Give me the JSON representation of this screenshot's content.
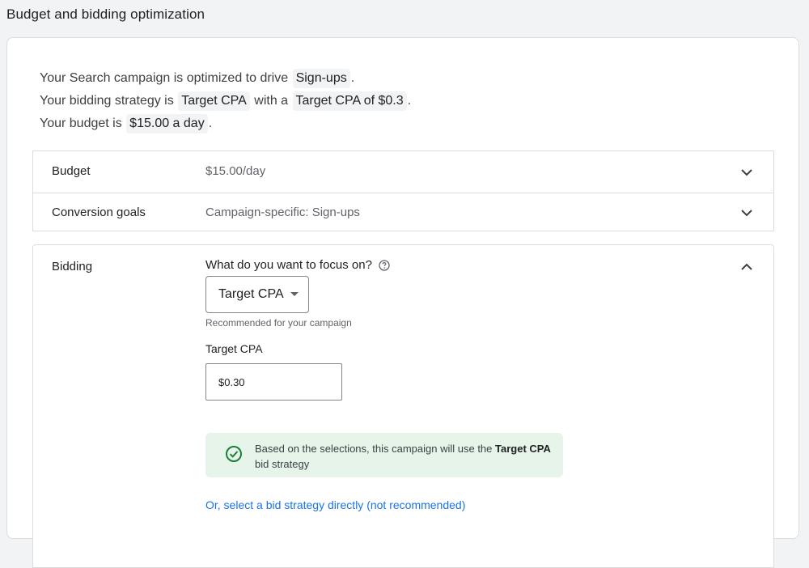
{
  "header": {
    "title": "Budget and bidding optimization"
  },
  "summary": {
    "line1_prefix": "Your Search campaign is optimized to drive",
    "line1_chip": "Sign-ups",
    "line1_suffix": ".",
    "line2_prefix": "Your bidding strategy is",
    "line2_chip1": "Target CPA",
    "line2_mid": "with a",
    "line2_chip2": "Target CPA of $0.3",
    "line2_suffix": ".",
    "line3_prefix": "Your budget is",
    "line3_chip": "$15.00 a day",
    "line3_suffix": "."
  },
  "rows": {
    "budget": {
      "label": "Budget",
      "value": "$15.00/day"
    },
    "conversion": {
      "label": "Conversion goals",
      "value": "Campaign-specific: Sign-ups"
    }
  },
  "bidding": {
    "label": "Bidding",
    "question": "What do you want to focus on?",
    "selected": "Target CPA",
    "recommended": "Recommended for your campaign",
    "tcpa_label": "Target CPA",
    "tcpa_value": "$0.30",
    "notice_prefix": "Based on the selections, this campaign will use the",
    "notice_bold": "Target CPA",
    "notice_suffix": "bid strategy",
    "direct_link": "Or, select a bid strategy directly (not recommended)"
  },
  "colors": {
    "accent": "#1a73e8",
    "success": "#188038",
    "notice_bg": "#e6f4ea"
  }
}
